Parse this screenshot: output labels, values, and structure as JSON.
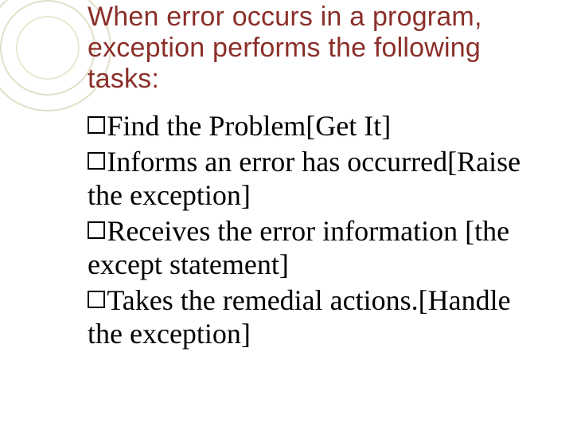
{
  "title": "When error occurs in a program, exception performs the following tasks:",
  "items": [
    "Find the Problem[Get It]",
    "Informs an error has occurred[Raise the exception]",
    "Receives the error information [the except statement]",
    "Takes the remedial actions.[Handle the exception]"
  ]
}
